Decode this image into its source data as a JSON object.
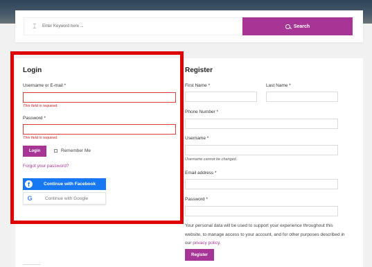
{
  "search": {
    "placeholder": "Enter Keyword here ...",
    "button_label": "Search"
  },
  "login": {
    "title": "Login",
    "username_label": "Username or E-mail *",
    "username_error": "This field is required.",
    "password_label": "Password *",
    "password_error": "This field is required.",
    "login_button": "Login",
    "remember_me": "Remember Me",
    "forgot_password": "Forgot your password?",
    "facebook_button": "Continue with Facebook",
    "google_button": "Continue with Google"
  },
  "register": {
    "title": "Register",
    "first_name_label": "First Name *",
    "last_name_label": "Last Name *",
    "phone_label": "Phone Number *",
    "username_label": "Username *",
    "username_note": "Username cannot be changed.",
    "email_label": "Email address *",
    "password_label": "Password *",
    "policy_text": "Your personal data will be used to support your experience throughout this website, to manage access to your account, and for other purposes described in our",
    "policy_link": "privacy policy",
    "policy_end": ".",
    "register_button": "Register"
  },
  "colors": {
    "accent": "#a63595",
    "facebook": "#1877f2",
    "highlight_border": "#e00000",
    "error": "#d02020"
  }
}
